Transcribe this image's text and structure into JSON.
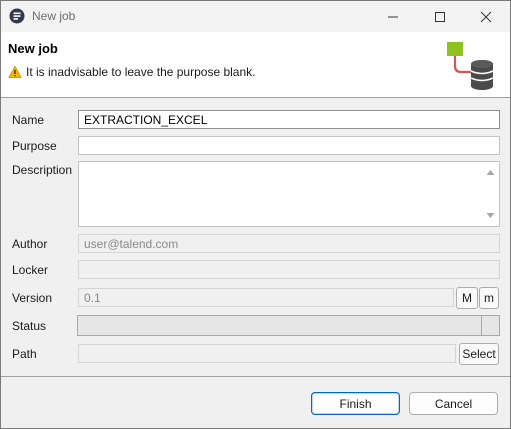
{
  "window": {
    "title": "New job",
    "icon": "talend-app-icon",
    "controls": [
      "minimize-icon",
      "maximize-icon",
      "close-icon"
    ]
  },
  "header": {
    "title": "New job",
    "message": "It is inadvisable to leave the purpose blank.",
    "message_icon": "warning-icon",
    "logo_icon": "job-database-icon"
  },
  "form": {
    "name": {
      "label": "Name",
      "value": "EXTRACTION_EXCEL"
    },
    "purpose": {
      "label": "Purpose",
      "value": ""
    },
    "description": {
      "label": "Description",
      "value": ""
    },
    "author": {
      "label": "Author",
      "value": "user@talend.com"
    },
    "locker": {
      "label": "Locker",
      "value": ""
    },
    "version": {
      "label": "Version",
      "value": "0.1",
      "major_label": "M",
      "minor_label": "m"
    },
    "status": {
      "label": "Status",
      "value": ""
    },
    "path": {
      "label": "Path",
      "value": "",
      "select_label": "Select"
    }
  },
  "footer": {
    "finish_label": "Finish",
    "cancel_label": "Cancel"
  },
  "colors": {
    "accent": "#0067c0",
    "logo_green": "#8dc21f",
    "logo_red": "#d9534f",
    "logo_db": "#4a4a4a",
    "warning": "#f2b705"
  }
}
